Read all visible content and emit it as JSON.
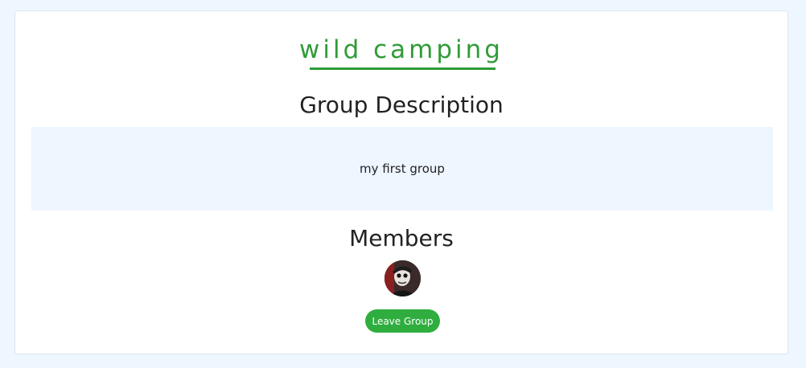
{
  "group": {
    "name": "wild camping",
    "accent_color": "#2f9c37"
  },
  "description": {
    "heading": "Group Description",
    "text": "my first group"
  },
  "members": {
    "heading": "Members",
    "list": [
      {
        "avatar_icon": "member-avatar-photo"
      }
    ]
  },
  "actions": {
    "leave_label": "Leave Group",
    "leave_color": "#2fae3f"
  }
}
